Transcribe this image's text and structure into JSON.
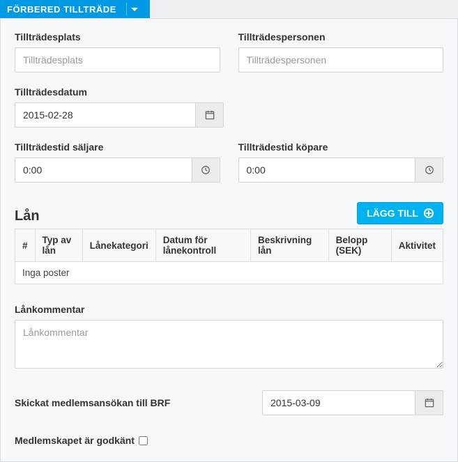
{
  "header": {
    "title": "FÖRBERED TILLTRÄDE"
  },
  "fields": {
    "tilltradesplats": {
      "label": "Tillträdesplats",
      "placeholder": "Tillträdesplats",
      "value": ""
    },
    "tilltradespersonen": {
      "label": "Tillträdespersonen",
      "placeholder": "Tillträdespersonen",
      "value": ""
    },
    "tilltradesdatum": {
      "label": "Tillträdesdatum",
      "value": "2015-02-28"
    },
    "tid_saljare": {
      "label": "Tillträdestid säljare",
      "value": "0:00"
    },
    "tid_kopare": {
      "label": "Tillträdestid köpare",
      "value": "0:00"
    }
  },
  "lan": {
    "title": "Lån",
    "add_label": "LÄGG TILL",
    "columns": [
      "#",
      "Typ av lån",
      "Lånekategori",
      "Datum för lånekontroll",
      "Beskrivning lån",
      "Belopp (SEK)",
      "Aktivitet"
    ],
    "empty_text": "Inga poster"
  },
  "lankommentar": {
    "label": "Lånkommentar",
    "placeholder": "Lånkommentar",
    "value": ""
  },
  "brf": {
    "label": "Skickat medlemsansökan till BRF",
    "value": "2015-03-09"
  },
  "godkant": {
    "label": "Medlemskapet är godkänt",
    "checked": false
  }
}
